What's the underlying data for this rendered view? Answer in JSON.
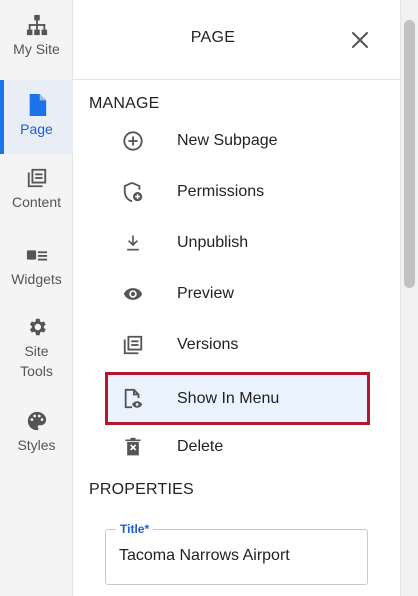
{
  "rail": {
    "items": [
      {
        "label": "My Site",
        "icon": "sitemap-icon"
      },
      {
        "label": "Page",
        "icon": "page-icon",
        "active": true
      },
      {
        "label": "Content",
        "icon": "content-icon"
      },
      {
        "label": "Widgets",
        "icon": "widgets-icon"
      },
      {
        "label": "Site\nTools",
        "icon": "gear-icon"
      },
      {
        "label": "Styles",
        "icon": "palette-icon"
      }
    ],
    "active_color": "#1a73e8"
  },
  "panel": {
    "title": "PAGE",
    "manage_title": "MANAGE",
    "manage_items": [
      {
        "label": "New Subpage",
        "icon": "plus-circle-icon"
      },
      {
        "label": "Permissions",
        "icon": "shield-add-icon"
      },
      {
        "label": "Unpublish",
        "icon": "download-icon"
      },
      {
        "label": "Preview",
        "icon": "eye-icon"
      },
      {
        "label": "Versions",
        "icon": "versions-icon"
      },
      {
        "label": "Show In Menu",
        "icon": "file-eye-icon",
        "highlighted": true
      },
      {
        "label": "Delete",
        "icon": "trash-icon"
      }
    ],
    "properties_title": "PROPERTIES",
    "title_field": {
      "label": "Title",
      "required_mark": "*",
      "value": "Tacoma Narrows Airport"
    }
  },
  "colors": {
    "highlight_border": "#b5162f",
    "highlight_fill": "#eaf2fd",
    "accent": "#1a5fd6"
  }
}
